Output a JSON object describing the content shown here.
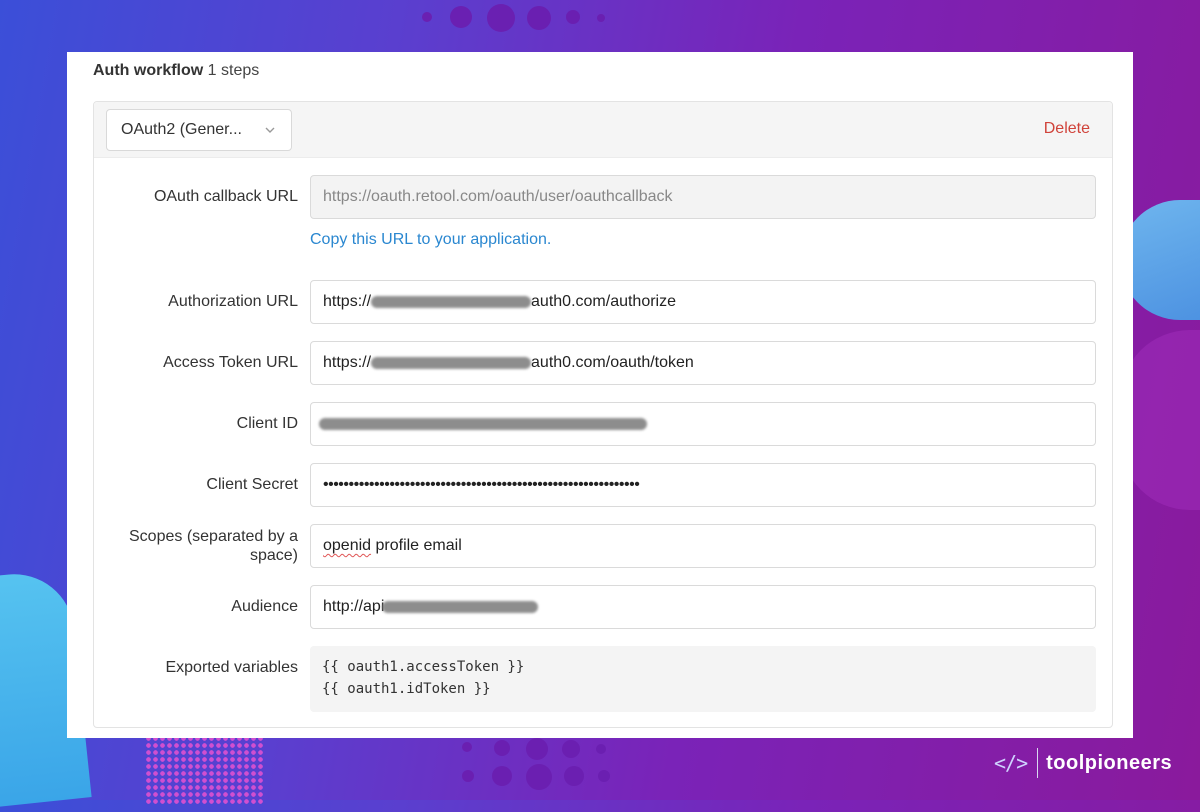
{
  "panel": {
    "title_strong": "Auth workflow",
    "title_count": "1 steps"
  },
  "step": {
    "type_select": "OAuth2 (Gener...",
    "delete_label": "Delete"
  },
  "fields": {
    "callback_label": "OAuth callback URL",
    "callback_value": "https://oauth.retool.com/oauth/user/oauthcallback",
    "callback_hint": "Copy this URL to your application.",
    "auth_url_label": "Authorization URL",
    "auth_url_prefix": "https://",
    "auth_url_suffix": "auth0.com/authorize",
    "token_url_label": "Access Token URL",
    "token_url_prefix": "https://",
    "token_url_suffix": "auth0.com/oauth/token",
    "client_id_label": "Client ID",
    "client_secret_label": "Client Secret",
    "client_secret_value": "••••••••••••••••••••••••••••••••••••••••••••••••••••••••••••••",
    "scopes_label_line1": "Scopes (separated by a",
    "scopes_label_line2": "space)",
    "scopes_word1": "openid",
    "scopes_rest": " profile email",
    "audience_label": "Audience",
    "audience_prefix": "http://api",
    "exported_label": "Exported variables",
    "exported_line1": "{{ oauth1.accessToken }}",
    "exported_line2": "{{ oauth1.idToken }}"
  },
  "brand": {
    "mark": "</>",
    "name": "toolpioneers"
  },
  "colors": {
    "delete": "#d0433a",
    "hint_link": "#2a87d0",
    "background_start": "#3b4fd8",
    "background_end": "#8a1a9c"
  }
}
